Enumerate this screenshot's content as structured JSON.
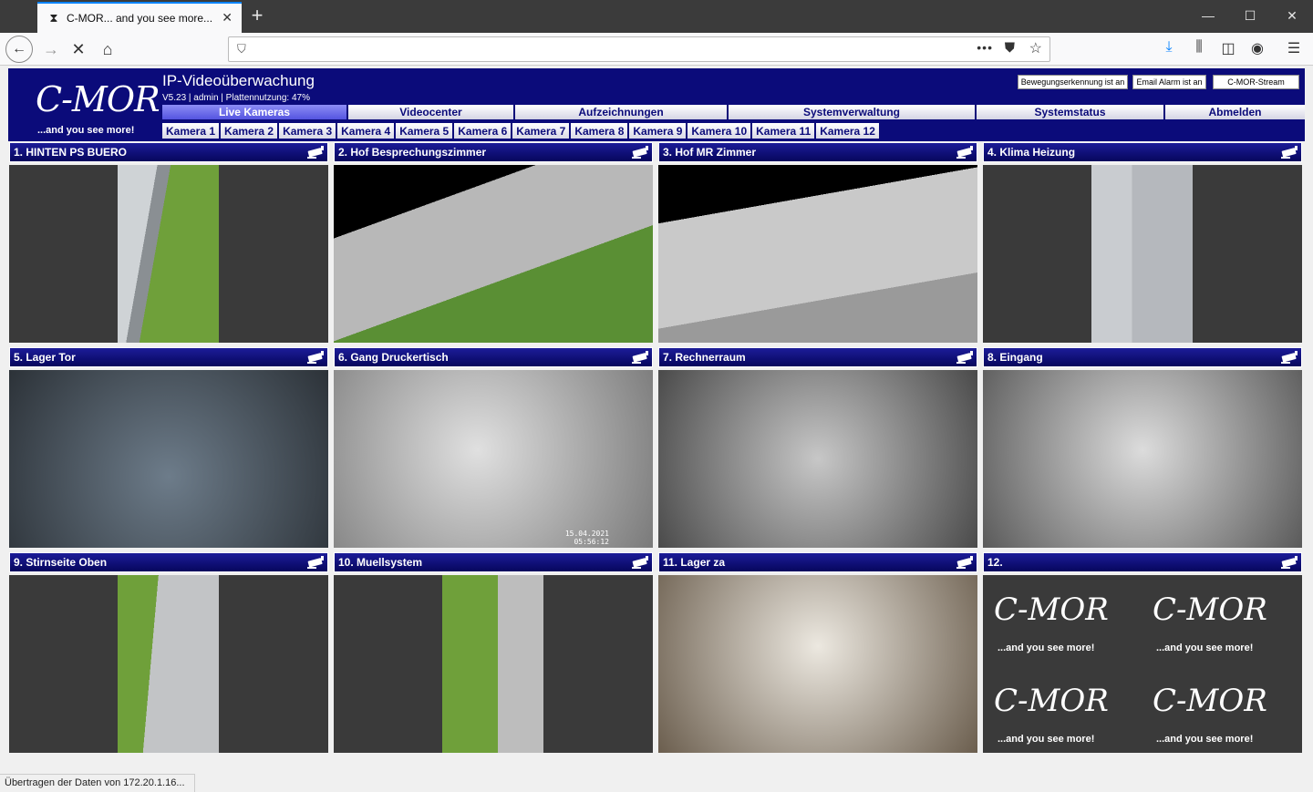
{
  "browser": {
    "tab_title": "C-MOR... and you see more...",
    "url": "",
    "status_text": "Übertragen der Daten von 172.20.1.16..."
  },
  "app": {
    "logo_text": "C-MOR",
    "logo_sub": "...and you see more!",
    "title": "IP-Videoüberwachung",
    "subtitle": "V5.23 | admin | Plattennutzung: 47%",
    "buttons": [
      {
        "label": "Bewegungserkennung ist an"
      },
      {
        "label": "Email Alarm ist an"
      },
      {
        "label": "C-MOR-Stream"
      }
    ],
    "main_nav": [
      {
        "label": "Live Kameras",
        "active": true
      },
      {
        "label": "Videocenter"
      },
      {
        "label": "Aufzeichnungen"
      },
      {
        "label": "Systemverwaltung"
      },
      {
        "label": "Systemstatus"
      },
      {
        "label": "Abmelden"
      }
    ],
    "camera_nav": [
      "Kamera 1",
      "Kamera 2",
      "Kamera 3",
      "Kamera 4",
      "Kamera 5",
      "Kamera 6",
      "Kamera 7",
      "Kamera 8",
      "Kamera 9",
      "Kamera 10",
      "Kamera 11",
      "Kamera 12"
    ]
  },
  "cameras": [
    {
      "title": "1. HINTEN PS BUERO",
      "feed": "narrow",
      "scene": "building-wall-grass"
    },
    {
      "title": "2. Hof Besprechungszimmer",
      "feed": "full",
      "scene": "courtyard-lawn-car"
    },
    {
      "title": "3. Hof MR Zimmer",
      "feed": "full",
      "scene": "parking-cars"
    },
    {
      "title": "4. Klima Heizung",
      "feed": "narrow",
      "scene": "wall-ac-units"
    },
    {
      "title": "5. Lager Tor",
      "feed": "full",
      "scene": "warehouse-gate"
    },
    {
      "title": "6. Gang Druckertisch",
      "feed": "full",
      "scene": "corridor",
      "overlay": "15.04.2021 05:56:12"
    },
    {
      "title": "7. Rechnerraum",
      "feed": "full",
      "scene": "server-room"
    },
    {
      "title": "8. Eingang",
      "feed": "full",
      "scene": "entrance"
    },
    {
      "title": "9. Stirnseite Oben",
      "feed": "narrow",
      "scene": "wall-grass"
    },
    {
      "title": "10. Muellsystem",
      "feed": "narrow",
      "scene": "grass-path"
    },
    {
      "title": "11. Lager za",
      "feed": "full",
      "scene": "storage-shelves"
    },
    {
      "title": "12.",
      "feed": "placeholder",
      "scene": "c-mor-logos"
    }
  ],
  "colors": {
    "header_bg": "#0b0b7a",
    "active_nav": "#6b6bea"
  }
}
